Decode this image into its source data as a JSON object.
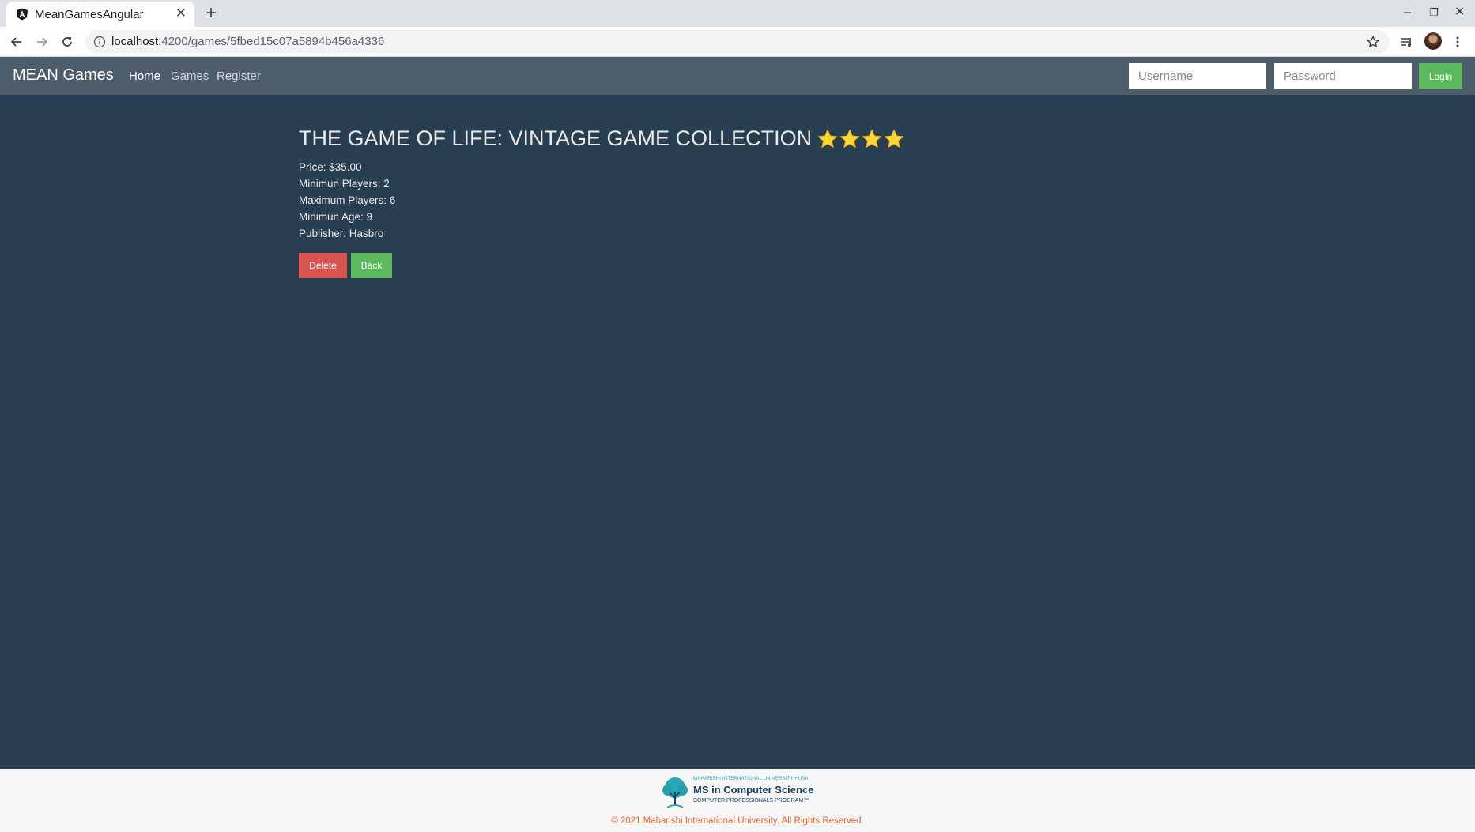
{
  "browser": {
    "tab_title": "MeanGamesAngular",
    "url_host": "localhost",
    "url_rest": ":4200/games/5fbed15c07a5894b456a4336"
  },
  "navbar": {
    "brand": "MEAN Games",
    "links": [
      "Home",
      "Games",
      "Register"
    ],
    "username_placeholder": "Username",
    "password_placeholder": "Password",
    "login_label": "Login"
  },
  "game": {
    "title": "THE GAME OF LIFE: VINTAGE GAME COLLECTION",
    "rating": 4,
    "rating_max": 4,
    "details": [
      "Price: $35.00",
      "Minimun Players: 2",
      "Maximum Players: 6",
      "Minimun Age: 9",
      "Publisher: Hasbro"
    ],
    "delete_label": "Delete",
    "back_label": "Back"
  },
  "footer": {
    "logo_small": "MAHARISHI INTERNATIONAL UNIVERSITY • USA",
    "logo_main": "MS in Computer Science",
    "logo_sub": "COMPUTER PROFESSIONALS PROGRAM™",
    "copyright": "© 2021 Maharishi International University. All Rights Reserved."
  },
  "colors": {
    "page_bg": "#283e51",
    "navbar_bg": "#4e5d6c",
    "success": "#5cb85c",
    "danger": "#d9534f",
    "star": "#fdd835",
    "footer_text": "#e8612c"
  }
}
